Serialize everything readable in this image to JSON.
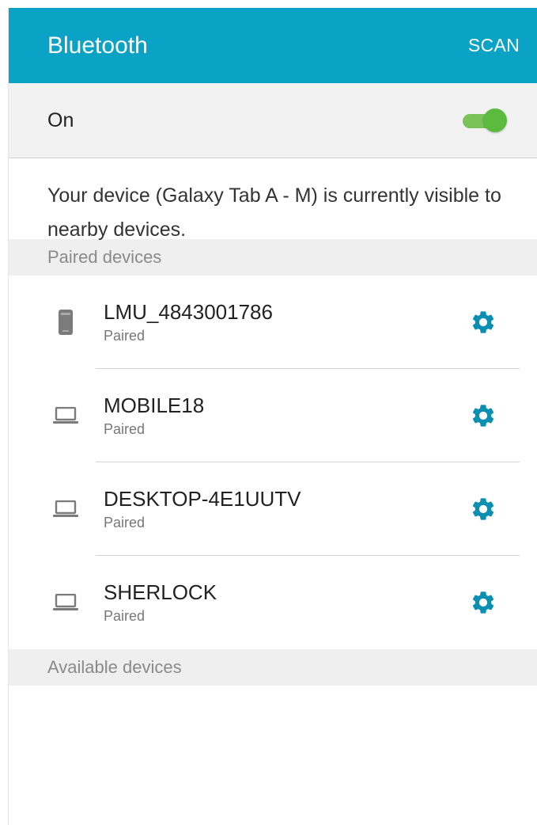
{
  "appbar": {
    "title": "Bluetooth",
    "scan_label": "SCAN"
  },
  "master_switch": {
    "label": "On",
    "state": "on"
  },
  "info": {
    "text": "Your device (Galaxy Tab A - M) is currently visible to nearby devices."
  },
  "paired_section": {
    "title": "Paired devices"
  },
  "paired_devices": [
    {
      "name": "LMU_4843001786",
      "status": "Paired",
      "icon": "phone-icon"
    },
    {
      "name": "MOBILE18",
      "status": "Paired",
      "icon": "laptop-icon"
    },
    {
      "name": "DESKTOP-4E1UUTV",
      "status": "Paired",
      "icon": "laptop-icon"
    },
    {
      "name": "SHERLOCK",
      "status": "Paired",
      "icon": "laptop-icon"
    }
  ],
  "available_section": {
    "title": "Available devices"
  },
  "colors": {
    "appbar": "#0aa3c6",
    "accent": "#0a8fb0",
    "switch_on": "#5cbb3e",
    "section_bg": "#efefef"
  }
}
